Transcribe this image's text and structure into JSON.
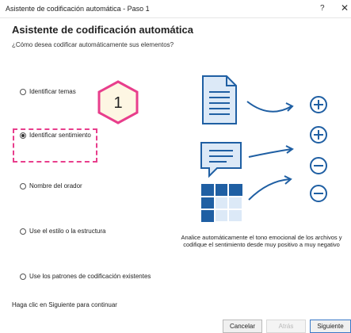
{
  "window": {
    "title": "Asistente de codificación automática - Paso 1",
    "help_label": "?",
    "close_label": "✕"
  },
  "heading": "Asistente de codificación automática",
  "subheading": "¿Cómo desea codificar automáticamente sus elementos?",
  "options": [
    {
      "label": "Identificar temas",
      "checked": false
    },
    {
      "label": "Identificar sentimiento",
      "checked": true
    },
    {
      "label": "Nombre del orador",
      "checked": false
    },
    {
      "label": "Use el estilo o la estructura",
      "checked": false
    },
    {
      "label": "Use los patrones de codificación existentes",
      "checked": false
    }
  ],
  "callout_number": "1",
  "description": "Analice automáticamente el tono emocional de los archivos y codifique el sentimiento desde muy positivo a muy negativo",
  "footer_text": "Haga clic en Siguiente para continuar",
  "buttons": {
    "cancel": "Cancelar",
    "back": "Atrás",
    "next": "Siguiente"
  },
  "colors": {
    "illustration_blue": "#1f5fa3",
    "illustration_fill": "#dce9f7",
    "callout_pink": "#e83e8c",
    "callout_fill": "#fdf6e3"
  },
  "icons": {
    "document": "document-icon",
    "comment": "comment-icon",
    "grid": "grid-icon",
    "plus": "plus-circle-icon",
    "minus": "minus-circle-icon",
    "arrow": "curved-arrow-icon"
  }
}
